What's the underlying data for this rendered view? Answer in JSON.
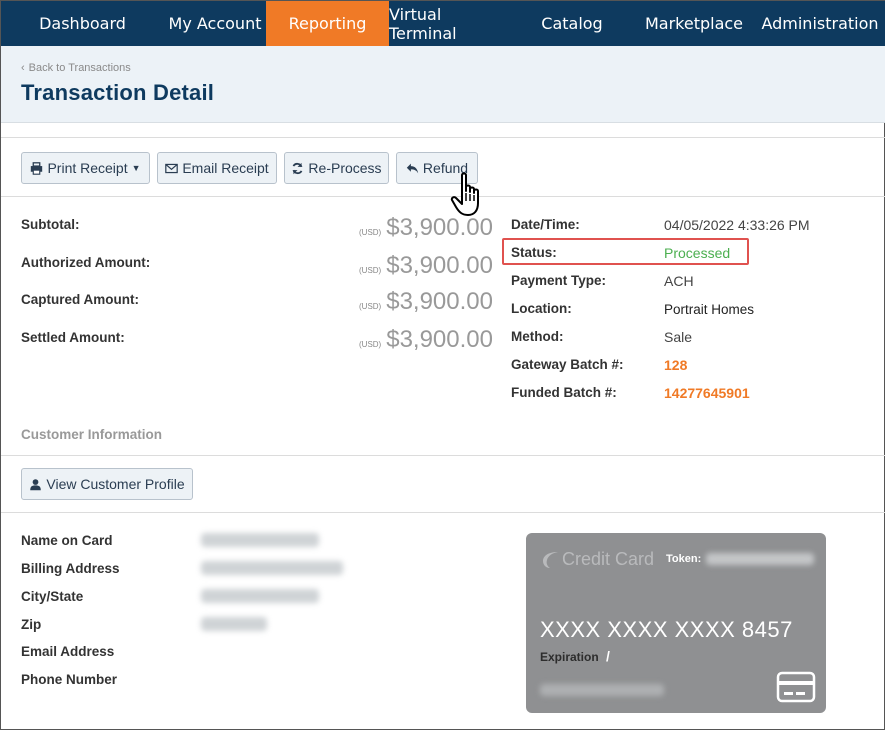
{
  "nav": {
    "items": [
      {
        "label": "Dashboard"
      },
      {
        "label": "My Account"
      },
      {
        "label": "Reporting"
      },
      {
        "label": "Virtual Terminal"
      },
      {
        "label": "Catalog"
      },
      {
        "label": "Marketplace"
      },
      {
        "label": "Administration"
      }
    ],
    "active": "Reporting",
    "active_color": "#f07a26",
    "bg_color": "#0e3a5f"
  },
  "header": {
    "back_link": "Back to Transactions",
    "title": "Transaction Detail"
  },
  "toolbar": {
    "print_label": "Print Receipt",
    "email_label": "Email Receipt",
    "reprocess_label": "Re-Process",
    "refund_label": "Refund"
  },
  "amounts": [
    {
      "label": "Subtotal:",
      "currency": "(USD)",
      "value": "$3,900.00"
    },
    {
      "label": "Authorized Amount:",
      "currency": "(USD)",
      "value": "$3,900.00"
    },
    {
      "label": "Captured Amount:",
      "currency": "(USD)",
      "value": "$3,900.00"
    },
    {
      "label": "Settled Amount:",
      "currency": "(USD)",
      "value": "$3,900.00"
    }
  ],
  "details": [
    {
      "label": "Date/Time:",
      "value": "04/05/2022 4:33:26 PM"
    },
    {
      "label": "Status:",
      "value": "Processed"
    },
    {
      "label": "Payment Type:",
      "value": "ACH"
    },
    {
      "label": "Location:",
      "value": "Portrait Homes"
    },
    {
      "label": "Method:",
      "value": "Sale"
    },
    {
      "label": "Gateway Batch #:",
      "value": "128"
    },
    {
      "label": "Funded Batch #:",
      "value": "14277645901"
    }
  ],
  "customer": {
    "section_title": "Customer Information",
    "view_profile_label": "View Customer Profile",
    "fields": [
      {
        "label": "Name on Card"
      },
      {
        "label": "Billing Address"
      },
      {
        "label": "City/State"
      },
      {
        "label": "Zip"
      },
      {
        "label": "Email Address"
      },
      {
        "label": "Phone Number"
      }
    ]
  },
  "card": {
    "brand": "Credit Card",
    "token_label": "Token:",
    "number": "XXXX XXXX XXXX 8457",
    "expiration_label": "Expiration",
    "expiration_value": "/"
  },
  "colors": {
    "status_green": "#4caf50",
    "batch_orange": "#f07a26",
    "highlight_red": "#e0524f"
  }
}
